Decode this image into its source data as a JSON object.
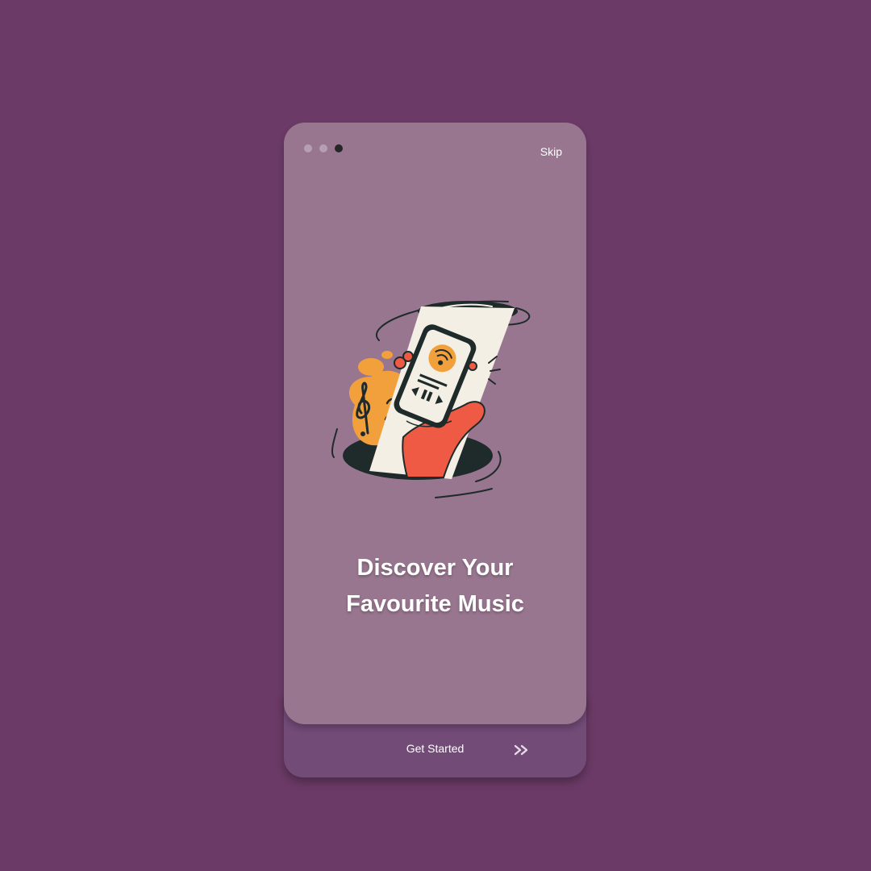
{
  "onboarding": {
    "skip_label": "Skip",
    "page_indicator": {
      "total": 3,
      "current": 3
    },
    "headline_line1": "Discover Your",
    "headline_line2": "Favourite Music",
    "cta_label": "Get Started",
    "cta_icon": "double-chevron-right-icon",
    "illustration_icon": "music-phone-illustration"
  },
  "colors": {
    "background": "#6b3a66",
    "card": "#98768f",
    "bottom_panel": "#724b77",
    "accent_orange": "#f2a03c",
    "accent_red": "#ee5a43",
    "dark": "#1f2a2a"
  }
}
